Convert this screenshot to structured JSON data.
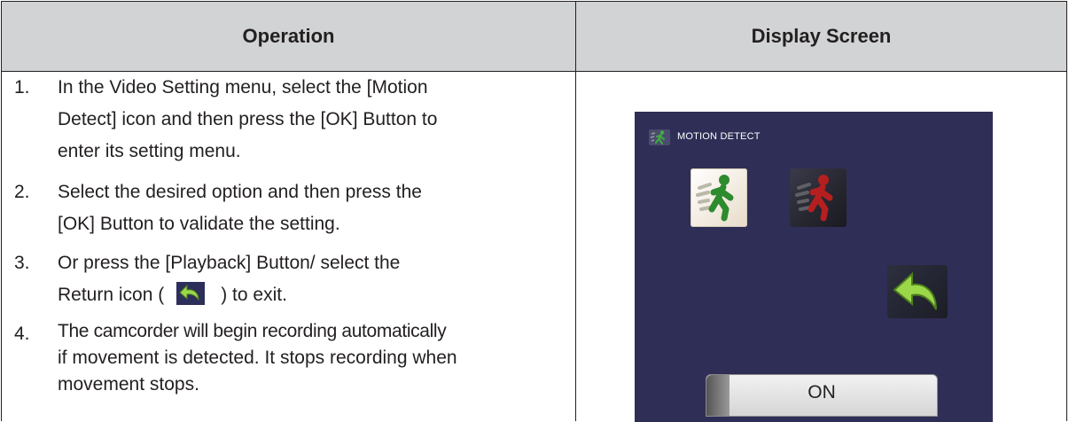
{
  "table": {
    "header": {
      "operation": "Operation",
      "display_screen": "Display Screen"
    },
    "steps": [
      {
        "number": "1.",
        "line1": "In the Video Setting menu, select the [Motion",
        "line2": "Detect] icon and then press the [OK] Button to",
        "line3": "enter its setting menu."
      },
      {
        "number": "2.",
        "line1": "Select the desired option and then press the",
        "line2": "[OK] Button to validate the setting."
      },
      {
        "number": "3.",
        "line1": "Or press the [Playback] Button/ select the",
        "line2_before": "Return icon (",
        "line2_after": ") to exit.",
        "inline_icon": "return-icon"
      },
      {
        "number": "4.",
        "line1": "The camcorder will begin recording automatically",
        "line2": "if movement is detected. It stops recording when",
        "line3": "movement stops."
      }
    ]
  },
  "display": {
    "menu_title": "MOTION DETECT",
    "title_icon": "motion-detect-icon",
    "options": [
      {
        "icon": "motion-detect-on-icon",
        "selected": true
      },
      {
        "icon": "motion-detect-off-icon",
        "selected": false
      }
    ],
    "return_icon": "return-icon",
    "selected_value": "ON"
  },
  "colors": {
    "header_background": "#d1d3d4",
    "screen_background": "#2f2e57",
    "text": "#231f20",
    "figure_on": "#2e8b2e",
    "figure_off": "#b51f1f",
    "return_arrow": "#9ad84a"
  }
}
